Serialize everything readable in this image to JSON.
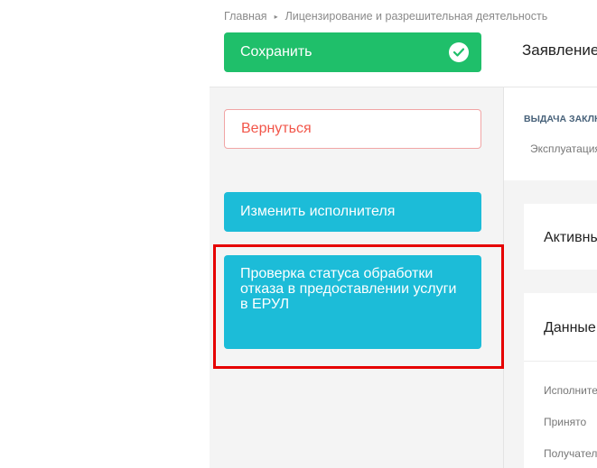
{
  "breadcrumb": {
    "home": "Главная",
    "separator": "▸",
    "section": "Лицензирование и разрешительная деятельность"
  },
  "toolbar": {
    "save_label": "Сохранить",
    "save_icon": "check-circle-icon"
  },
  "page": {
    "title": "Заявление"
  },
  "sidebar": {
    "back_label": "Вернуться",
    "change_executor_label": "Изменить исполнителя",
    "check_status_label": "Проверка статуса обработки отказа в предоставлении услуги в ЕРУЛ"
  },
  "main": {
    "service_title": "ВЫДАЧА ЗАКЛЮЧЕНИЯ",
    "service_subtitle": "Эксплуатация",
    "active_card_title": "Активные",
    "data_card_title": "Данные",
    "fields": [
      "Исполнитель",
      "Принято",
      "Получатель"
    ]
  },
  "colors": {
    "save": "#1fbf6a",
    "primary": "#1cbcd8",
    "danger": "#f2564a",
    "highlight": "#e60000"
  }
}
